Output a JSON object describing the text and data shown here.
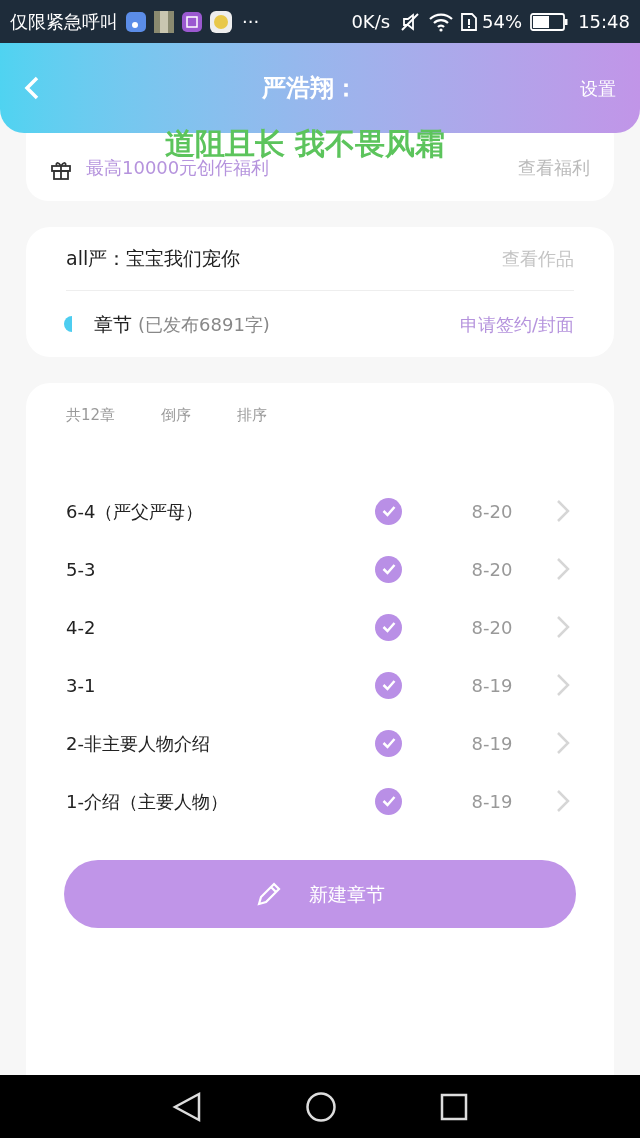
{
  "status_bar": {
    "carrier": "仅限紧急呼叫",
    "more": "···",
    "speed": "0K/s",
    "battery": "54%",
    "time": "15:48"
  },
  "header": {
    "title": "严浩翔：",
    "settings": "设置"
  },
  "caption": "道阻且长 我不畏风霜",
  "benefit": {
    "text": "最高10000元创作福利",
    "link": "查看福利"
  },
  "work": {
    "title": "all严：宝宝我们宠你",
    "link": "查看作品",
    "section": "章节",
    "count": "(已发布6891字)",
    "apply": "申请签约/封面"
  },
  "chapters_header": {
    "total": "共12章",
    "reverse": "倒序",
    "sort": "排序"
  },
  "chapters": [
    {
      "title": "6-4（严父严母）",
      "published": true,
      "date": "8-20"
    },
    {
      "title": "5-3",
      "published": true,
      "date": "8-20"
    },
    {
      "title": "4-2",
      "published": true,
      "date": "8-20"
    },
    {
      "title": "3-1",
      "published": true,
      "date": "8-19"
    },
    {
      "title": "2-非主要人物介绍",
      "published": true,
      "date": "8-19"
    },
    {
      "title": "1-介绍（主要人物）",
      "published": true,
      "date": "8-19"
    }
  ],
  "new_chapter": "新建章节"
}
